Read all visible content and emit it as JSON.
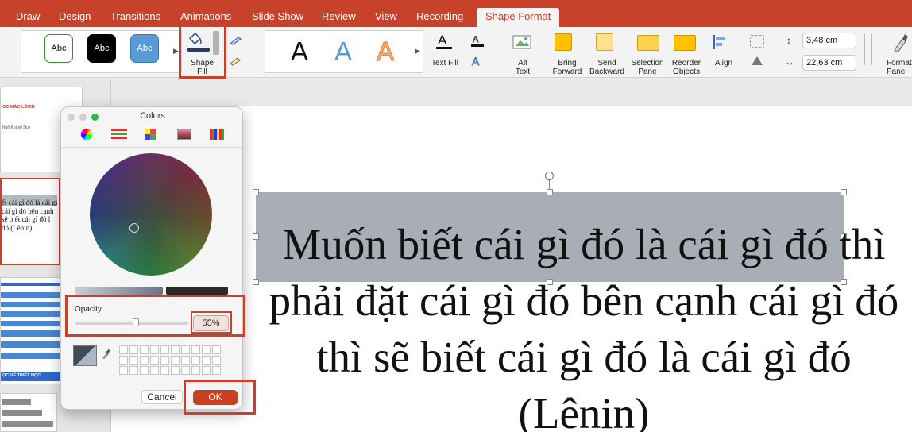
{
  "menu": {
    "tabs": [
      "Draw",
      "Design",
      "Transitions",
      "Animations",
      "Slide Show",
      "Review",
      "View",
      "Recording"
    ],
    "active_tab": "Shape Format"
  },
  "ribbon": {
    "shape_styles": [
      "Abc",
      "Abc",
      "Abc"
    ],
    "shape_fill_label": "Shape\nFill",
    "wordart_letters": [
      "A",
      "A",
      "A"
    ],
    "text_fill_label": "Text Fill",
    "alt_text_label": "Alt\nText",
    "bring_forward_label": "Bring\nForward",
    "send_backward_label": "Send\nBackward",
    "selection_pane_label": "Selection\nPane",
    "reorder_objects_label": "Reorder\nObjects",
    "align_label": "Align",
    "height_value": "3,48 cm",
    "width_value": "22,63 cm",
    "format_pane_label": "Format\nPane"
  },
  "thumbnail": {
    "title_fragment": "ỌC MÁC-LÊNIN",
    "author_fragment": "Ngô Khánh Duy",
    "quote_fragment": "ết cái gì đó là cái gì\ncái gì đó bên cạnh\nsẽ biết cái gì đó l\nđó (Lênin)",
    "section_fragment": "ỌC VỀ TRIẾT HỌC"
  },
  "colors_dialog": {
    "title": "Colors",
    "mode_icons": [
      "color-wheel-icon",
      "color-sliders-icon",
      "color-palettes-icon",
      "image-palettes-icon",
      "pencils-icon"
    ],
    "opacity_label": "Opacity",
    "opacity_value": "55%",
    "cancel_label": "Cancel",
    "ok_label": "OK"
  },
  "slide": {
    "text": "Muốn biết cái gì đó là cái gì đó thì phải đặt cái gì đó bên cạnh cái gì đó thì sẽ biết cái gì đó là cái gì đó (Lênin)"
  },
  "colors": {
    "accent": "#c8412b",
    "ok_button": "#c7401f",
    "shape_fill": "#a9adb5"
  }
}
